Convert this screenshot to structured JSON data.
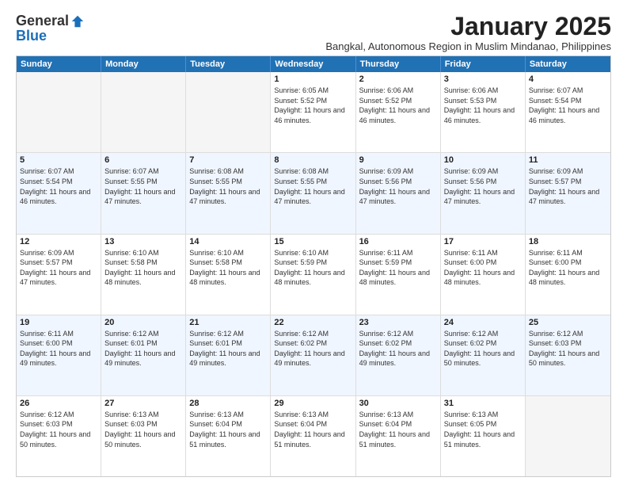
{
  "logo": {
    "general": "General",
    "blue": "Blue"
  },
  "title": "January 2025",
  "location": "Bangkal, Autonomous Region in Muslim Mindanao, Philippines",
  "days": [
    "Sunday",
    "Monday",
    "Tuesday",
    "Wednesday",
    "Thursday",
    "Friday",
    "Saturday"
  ],
  "rows": [
    [
      {
        "day": "",
        "sunrise": "",
        "sunset": "",
        "daylight": ""
      },
      {
        "day": "",
        "sunrise": "",
        "sunset": "",
        "daylight": ""
      },
      {
        "day": "",
        "sunrise": "",
        "sunset": "",
        "daylight": ""
      },
      {
        "day": "1",
        "sunrise": "Sunrise: 6:05 AM",
        "sunset": "Sunset: 5:52 PM",
        "daylight": "Daylight: 11 hours and 46 minutes."
      },
      {
        "day": "2",
        "sunrise": "Sunrise: 6:06 AM",
        "sunset": "Sunset: 5:52 PM",
        "daylight": "Daylight: 11 hours and 46 minutes."
      },
      {
        "day": "3",
        "sunrise": "Sunrise: 6:06 AM",
        "sunset": "Sunset: 5:53 PM",
        "daylight": "Daylight: 11 hours and 46 minutes."
      },
      {
        "day": "4",
        "sunrise": "Sunrise: 6:07 AM",
        "sunset": "Sunset: 5:54 PM",
        "daylight": "Daylight: 11 hours and 46 minutes."
      }
    ],
    [
      {
        "day": "5",
        "sunrise": "Sunrise: 6:07 AM",
        "sunset": "Sunset: 5:54 PM",
        "daylight": "Daylight: 11 hours and 46 minutes."
      },
      {
        "day": "6",
        "sunrise": "Sunrise: 6:07 AM",
        "sunset": "Sunset: 5:55 PM",
        "daylight": "Daylight: 11 hours and 47 minutes."
      },
      {
        "day": "7",
        "sunrise": "Sunrise: 6:08 AM",
        "sunset": "Sunset: 5:55 PM",
        "daylight": "Daylight: 11 hours and 47 minutes."
      },
      {
        "day": "8",
        "sunrise": "Sunrise: 6:08 AM",
        "sunset": "Sunset: 5:55 PM",
        "daylight": "Daylight: 11 hours and 47 minutes."
      },
      {
        "day": "9",
        "sunrise": "Sunrise: 6:09 AM",
        "sunset": "Sunset: 5:56 PM",
        "daylight": "Daylight: 11 hours and 47 minutes."
      },
      {
        "day": "10",
        "sunrise": "Sunrise: 6:09 AM",
        "sunset": "Sunset: 5:56 PM",
        "daylight": "Daylight: 11 hours and 47 minutes."
      },
      {
        "day": "11",
        "sunrise": "Sunrise: 6:09 AM",
        "sunset": "Sunset: 5:57 PM",
        "daylight": "Daylight: 11 hours and 47 minutes."
      }
    ],
    [
      {
        "day": "12",
        "sunrise": "Sunrise: 6:09 AM",
        "sunset": "Sunset: 5:57 PM",
        "daylight": "Daylight: 11 hours and 47 minutes."
      },
      {
        "day": "13",
        "sunrise": "Sunrise: 6:10 AM",
        "sunset": "Sunset: 5:58 PM",
        "daylight": "Daylight: 11 hours and 48 minutes."
      },
      {
        "day": "14",
        "sunrise": "Sunrise: 6:10 AM",
        "sunset": "Sunset: 5:58 PM",
        "daylight": "Daylight: 11 hours and 48 minutes."
      },
      {
        "day": "15",
        "sunrise": "Sunrise: 6:10 AM",
        "sunset": "Sunset: 5:59 PM",
        "daylight": "Daylight: 11 hours and 48 minutes."
      },
      {
        "day": "16",
        "sunrise": "Sunrise: 6:11 AM",
        "sunset": "Sunset: 5:59 PM",
        "daylight": "Daylight: 11 hours and 48 minutes."
      },
      {
        "day": "17",
        "sunrise": "Sunrise: 6:11 AM",
        "sunset": "Sunset: 6:00 PM",
        "daylight": "Daylight: 11 hours and 48 minutes."
      },
      {
        "day": "18",
        "sunrise": "Sunrise: 6:11 AM",
        "sunset": "Sunset: 6:00 PM",
        "daylight": "Daylight: 11 hours and 48 minutes."
      }
    ],
    [
      {
        "day": "19",
        "sunrise": "Sunrise: 6:11 AM",
        "sunset": "Sunset: 6:00 PM",
        "daylight": "Daylight: 11 hours and 49 minutes."
      },
      {
        "day": "20",
        "sunrise": "Sunrise: 6:12 AM",
        "sunset": "Sunset: 6:01 PM",
        "daylight": "Daylight: 11 hours and 49 minutes."
      },
      {
        "day": "21",
        "sunrise": "Sunrise: 6:12 AM",
        "sunset": "Sunset: 6:01 PM",
        "daylight": "Daylight: 11 hours and 49 minutes."
      },
      {
        "day": "22",
        "sunrise": "Sunrise: 6:12 AM",
        "sunset": "Sunset: 6:02 PM",
        "daylight": "Daylight: 11 hours and 49 minutes."
      },
      {
        "day": "23",
        "sunrise": "Sunrise: 6:12 AM",
        "sunset": "Sunset: 6:02 PM",
        "daylight": "Daylight: 11 hours and 49 minutes."
      },
      {
        "day": "24",
        "sunrise": "Sunrise: 6:12 AM",
        "sunset": "Sunset: 6:02 PM",
        "daylight": "Daylight: 11 hours and 50 minutes."
      },
      {
        "day": "25",
        "sunrise": "Sunrise: 6:12 AM",
        "sunset": "Sunset: 6:03 PM",
        "daylight": "Daylight: 11 hours and 50 minutes."
      }
    ],
    [
      {
        "day": "26",
        "sunrise": "Sunrise: 6:12 AM",
        "sunset": "Sunset: 6:03 PM",
        "daylight": "Daylight: 11 hours and 50 minutes."
      },
      {
        "day": "27",
        "sunrise": "Sunrise: 6:13 AM",
        "sunset": "Sunset: 6:03 PM",
        "daylight": "Daylight: 11 hours and 50 minutes."
      },
      {
        "day": "28",
        "sunrise": "Sunrise: 6:13 AM",
        "sunset": "Sunset: 6:04 PM",
        "daylight": "Daylight: 11 hours and 51 minutes."
      },
      {
        "day": "29",
        "sunrise": "Sunrise: 6:13 AM",
        "sunset": "Sunset: 6:04 PM",
        "daylight": "Daylight: 11 hours and 51 minutes."
      },
      {
        "day": "30",
        "sunrise": "Sunrise: 6:13 AM",
        "sunset": "Sunset: 6:04 PM",
        "daylight": "Daylight: 11 hours and 51 minutes."
      },
      {
        "day": "31",
        "sunrise": "Sunrise: 6:13 AM",
        "sunset": "Sunset: 6:05 PM",
        "daylight": "Daylight: 11 hours and 51 minutes."
      },
      {
        "day": "",
        "sunrise": "",
        "sunset": "",
        "daylight": ""
      }
    ]
  ]
}
